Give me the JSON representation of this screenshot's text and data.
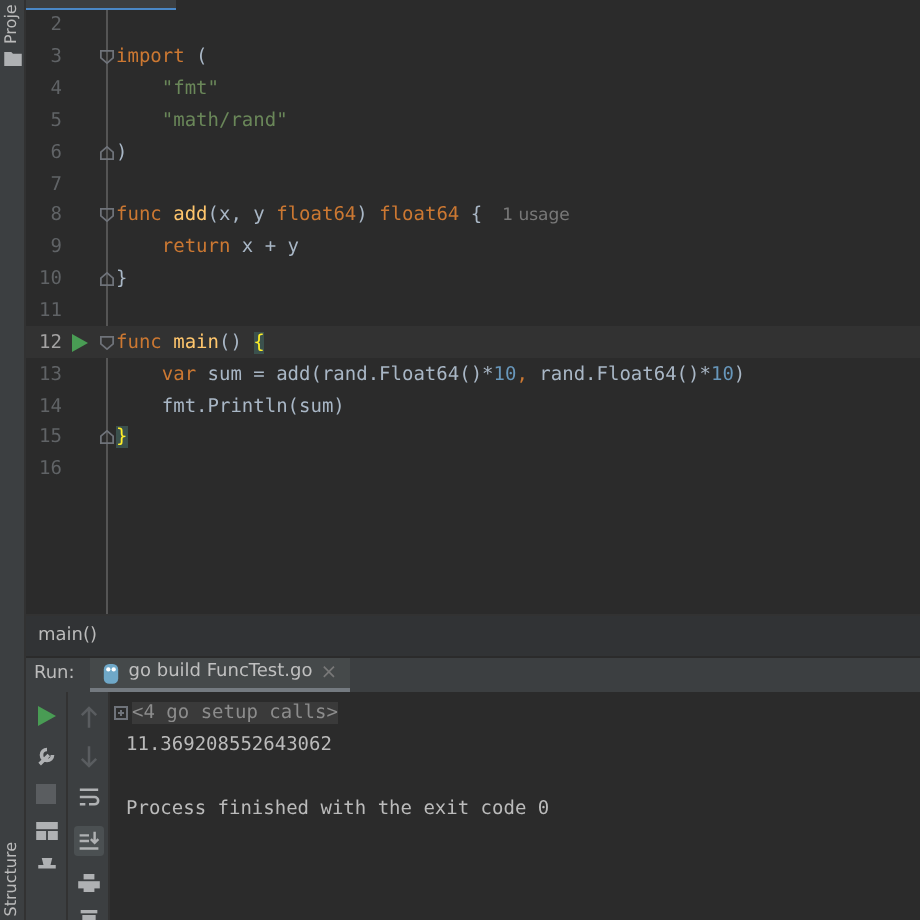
{
  "side_strip": {
    "top_label": "Proje",
    "bottom_label": "Structure"
  },
  "editor": {
    "lines": [
      {
        "number": "2",
        "current": false,
        "run": false
      },
      {
        "number": "3",
        "current": false,
        "run": false,
        "fold_start": true,
        "indented": false,
        "tokens": [
          {
            "kind": "keyword",
            "text": "import"
          },
          {
            "kind": "plain",
            "text": " ("
          }
        ]
      },
      {
        "number": "4",
        "current": false,
        "run": false,
        "indented": true,
        "tokens": [
          {
            "kind": "string",
            "text": "\"fmt\""
          }
        ]
      },
      {
        "number": "5",
        "current": false,
        "run": false,
        "indented": true,
        "tokens": [
          {
            "kind": "string",
            "text": "\"math/rand\""
          }
        ]
      },
      {
        "number": "6",
        "current": false,
        "run": false,
        "fold_end": true,
        "indented": false,
        "tokens": [
          {
            "kind": "plain",
            "text": ")"
          }
        ]
      },
      {
        "number": "7",
        "current": false,
        "run": false
      },
      {
        "number": "8",
        "current": false,
        "run": false,
        "fold_start": true,
        "indented": false,
        "tokens": [
          {
            "kind": "keyword",
            "text": "func"
          },
          {
            "kind": "function",
            "text": "add"
          },
          {
            "kind": "plain",
            "text": "(x, y "
          },
          {
            "kind": "keyword",
            "text": "float64"
          },
          {
            "kind": "plain",
            "text": ") "
          },
          {
            "kind": "keyword",
            "text": "float64"
          },
          {
            "kind": "plain",
            "text": " {"
          },
          {
            "kind": "hint",
            "text": "1 usage"
          }
        ]
      },
      {
        "number": "9",
        "current": false,
        "run": false,
        "indented": true,
        "tokens": [
          {
            "kind": "keyword",
            "text": "return"
          },
          {
            "kind": "plain",
            "text": " x + y"
          }
        ]
      },
      {
        "number": "10",
        "current": false,
        "run": false,
        "fold_end": true,
        "indented": false,
        "tokens": [
          {
            "kind": "plain",
            "text": "}"
          }
        ]
      },
      {
        "number": "11",
        "current": false,
        "run": false
      },
      {
        "number": "12",
        "current": true,
        "run": true,
        "fold_start": true,
        "indented": false,
        "tokens": [
          {
            "kind": "keyword",
            "text": "func"
          },
          {
            "kind": "function",
            "text": "main"
          },
          {
            "kind": "plain",
            "text": "() "
          },
          {
            "kind": "brace-match",
            "text": "{"
          }
        ]
      },
      {
        "number": "13",
        "current": false,
        "run": false,
        "indented": true,
        "tokens": [
          {
            "kind": "keyword",
            "text": "var"
          },
          {
            "kind": "plain",
            "text": " sum = add(rand.Float64()*"
          },
          {
            "kind": "number",
            "text": "10"
          },
          {
            "kind": "keyword",
            "text": ","
          },
          {
            "kind": "plain",
            "text": " rand.Float64()*"
          },
          {
            "kind": "number",
            "text": "10"
          },
          {
            "kind": "plain",
            "text": ")"
          }
        ]
      },
      {
        "number": "14",
        "current": false,
        "run": false,
        "indented": true,
        "tokens": [
          {
            "kind": "plain",
            "text": "fmt.Println(sum)"
          }
        ]
      },
      {
        "number": "15",
        "current": false,
        "run": false,
        "fold_end": true,
        "indented": false,
        "tokens": [
          {
            "kind": "brace-match",
            "text": "}"
          }
        ]
      },
      {
        "number": "16",
        "current": false,
        "run": false
      }
    ]
  },
  "breadcrumb": "main()",
  "run_panel": {
    "label": "Run:",
    "tab": {
      "title": "go build FuncTest.go",
      "close": "×",
      "selected": true
    },
    "console": [
      {
        "kind": "folded",
        "text": "<4 go setup calls>"
      },
      {
        "kind": "output",
        "text": "11.369208552643062"
      },
      {
        "kind": "process",
        "text": "Process finished with the exit code 0"
      }
    ]
  }
}
